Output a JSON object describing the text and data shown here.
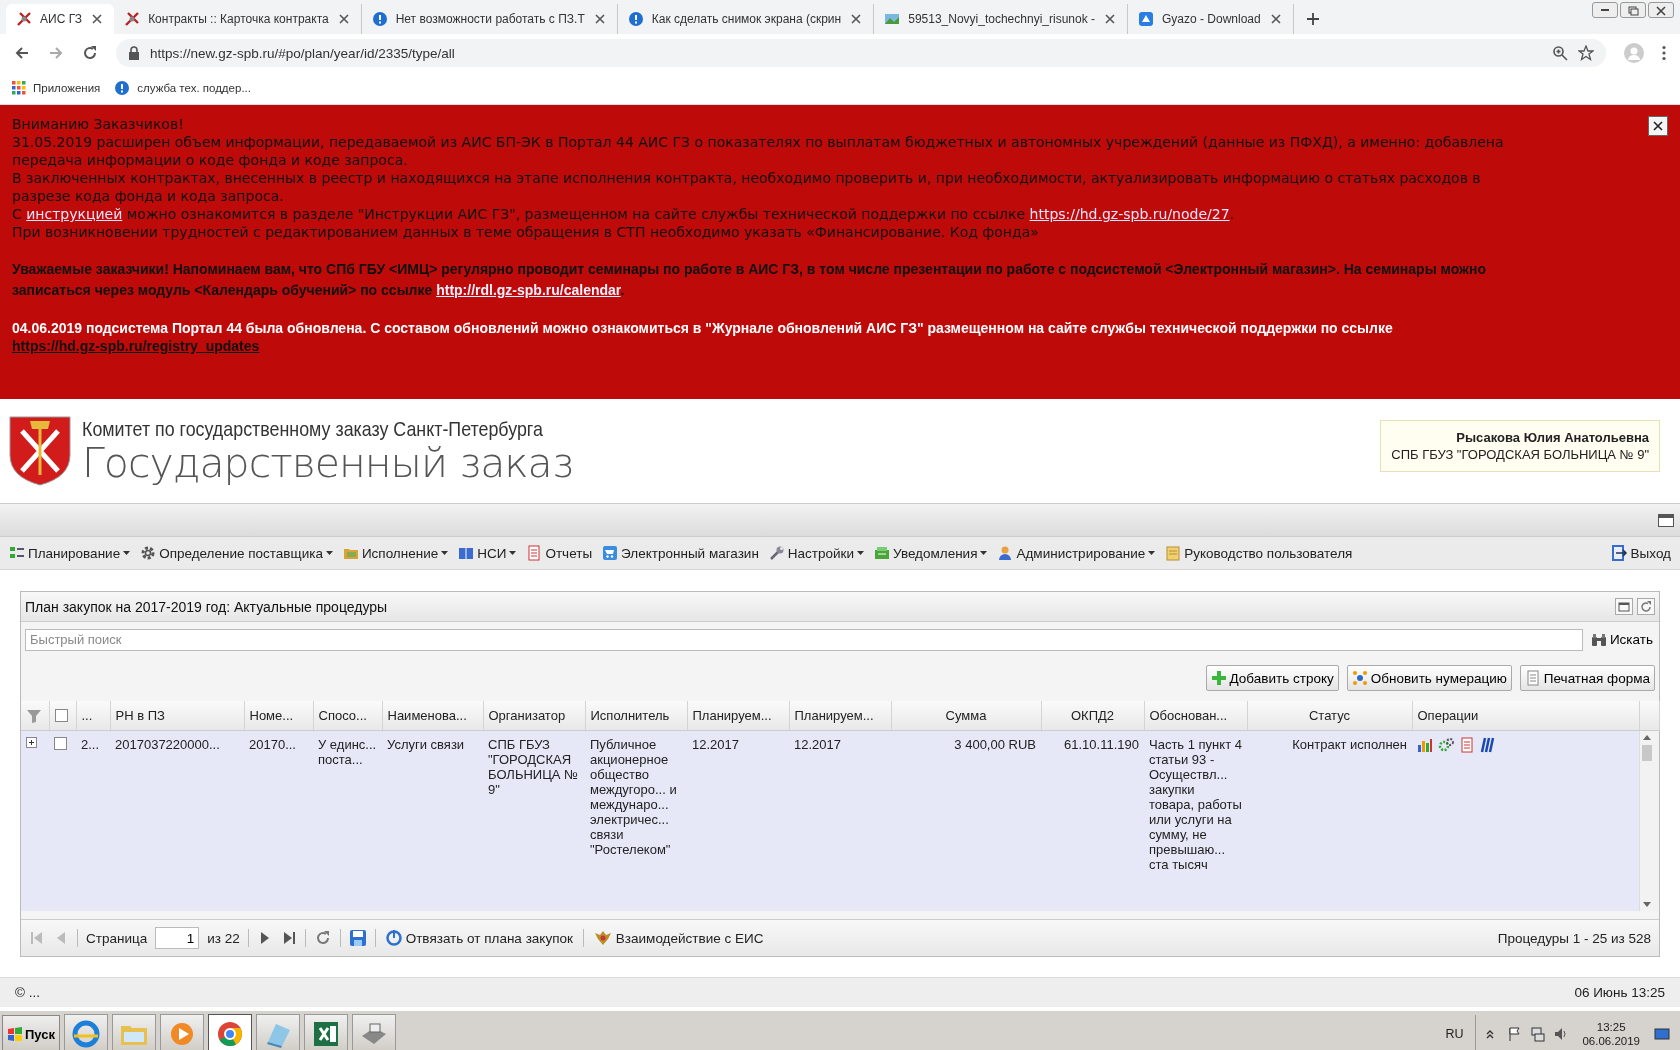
{
  "browser": {
    "tabs": [
      {
        "title": "АИС ГЗ",
        "selected": true
      },
      {
        "title": "Контракты :: Карточка контракта",
        "selected": false
      },
      {
        "title": "Нет возможности работать с ПЗ.Т",
        "selected": false
      },
      {
        "title": "Как сделать снимок экрана (скрин",
        "selected": false
      },
      {
        "title": "59513_Novyi_tochechnyi_risunok -",
        "selected": false
      },
      {
        "title": "Gyazo - Download",
        "selected": false
      }
    ],
    "address": "https://new.gz-spb.ru/#po/plan/year/id/2335/type/all",
    "bookmarks": [
      "Приложения",
      "служба тех. поддер..."
    ]
  },
  "banner": {
    "paragraphs": [
      {
        "kind": "notice",
        "lines": [
          [
            {
              "text": "Вниманию Заказчиков!"
            }
          ],
          [
            {
              "text": "31.05.2019 расширен объем информации, передаваемой из АИС БП-ЭК в Портал 44 АИС ГЗ о показателях по выплатам бюджетных и автономных учреждений (данные из ПФХД), а именно: добавлена передача информации о коде фонда и коде запроса."
            }
          ],
          [
            {
              "text": "В заключенных контрактах, внесенных в реестр и находящихся на этапе исполнения контракта, необходимо проверить и, при необходимости, актуализировать информацию о статьях расходов в разрезе кода фонда и кода запроса."
            }
          ],
          [
            {
              "text": "С "
            },
            {
              "link": "инструкцией"
            },
            {
              "text": " можно ознакомится в разделе \"Инструкции АИС ГЗ\", размещенном на сайте службы технической поддержки по ссылке "
            },
            {
              "link": "https://hd.gz-spb.ru/node/27"
            },
            {
              "text": "."
            }
          ],
          [
            {
              "text": "При возникновении трудностей с редактированием данных в теме обращения в СТП необходимо указать «Финансирование. Код фонда»"
            }
          ]
        ]
      },
      {
        "kind": "bold",
        "lines": [
          [
            {
              "text": "Уважаемые заказчики! Напоминаем вам, что СПб ГБУ <ИМЦ> регулярно проводит семинары по работе в АИС ГЗ, в том числе презентации по работе с подсистемой <Электронный магазин>. На семинары можно записаться через модуль <Календарь обучений> по ссылке "
            },
            {
              "link": "http://rdl.gz-spb.ru/calendar"
            },
            {
              "text": "."
            }
          ]
        ]
      },
      {
        "kind": "update",
        "lines": [
          [
            {
              "text": "04.06.2019 подсистема Портал 44 была обновлена. С составом обновлений можно ознакомиться в \"Журнале обновлений АИС ГЗ\" размещенном на сайте службы технической поддержки по ссылке "
            },
            {
              "link": "https://hd.gz-spb.ru/registry_updates"
            }
          ]
        ]
      }
    ]
  },
  "header": {
    "org": "Комитет по государственному заказу Санкт-Петербурга",
    "title": "Государственный заказ",
    "user": {
      "name": "Рысакова Юлия Анатольевна",
      "org": "СПБ ГБУЗ \"ГОРОДСКАЯ БОЛЬНИЦА № 9\""
    }
  },
  "menu": {
    "items": [
      {
        "label": "Планирование",
        "dropdown": true
      },
      {
        "label": "Определение поставщика",
        "dropdown": true
      },
      {
        "label": "Исполнение",
        "dropdown": true
      },
      {
        "label": "НСИ",
        "dropdown": true
      },
      {
        "label": "Отчеты",
        "dropdown": false
      },
      {
        "label": "Электронный магазин",
        "dropdown": false
      },
      {
        "label": "Настройки",
        "dropdown": true
      },
      {
        "label": "Уведомления",
        "dropdown": true
      },
      {
        "label": "Администрирование",
        "dropdown": true
      },
      {
        "label": "Руководство пользователя",
        "dropdown": false
      }
    ],
    "exit": "Выход"
  },
  "panel": {
    "title": "План закупок на 2017-2019 год: Актуальные процедуры",
    "search": {
      "placeholder": "Быстрый поиск",
      "button": "Искать"
    },
    "toolbar": [
      "Добавить строку",
      "Обновить нумерацию",
      "Печатная форма"
    ],
    "table": {
      "select_all": false,
      "columns": [
        "...",
        "РН в ПЗ",
        "Номе...",
        "Спосо...",
        "Наименова...",
        "Организатор",
        "Исполнитель",
        "Планируем...",
        "Планируем...",
        "Сумма",
        "ОКПД2",
        "Обоснован...",
        "Статус",
        "Операции"
      ],
      "rows": [
        {
          "expanded": false,
          "checked": false,
          "cells": [
            "2...",
            "2017037220000...",
            "20170...",
            "У единс... поста...",
            "Услуги связи",
            "СПБ ГБУЗ \"ГОРОДСКАЯ БОЛЬНИЦА № 9\"",
            "Публичное акционерное общество междугоро... и междунаро... электричес... связи \"Ростелеком\"",
            "12.2017",
            "12.2017",
            "3 400,00 RUB",
            "61.10.11.190",
            "Часть 1 пункт 4 статьи 93 - Осуществл... закупки товара, работы или услуги на сумму, не превышаю... ста тысяч",
            "Контракт исполнен"
          ]
        }
      ]
    },
    "pager": {
      "back": [
        {
          "kind": "first",
          "disabled": true
        },
        {
          "kind": "prev",
          "disabled": true
        }
      ],
      "page_label": "Страница",
      "page": "1",
      "of": "из 22",
      "forward": [
        {
          "kind": "next",
          "disabled": false
        },
        {
          "kind": "last",
          "disabled": false
        }
      ],
      "unlink": "Отвязать от плана закупок",
      "eis": "Взаимодействие с ЕИС",
      "summary": "Процедуры 1 - 25 из 528"
    }
  },
  "footer": {
    "copyright": "© ...",
    "datetime": "06 Июнь 13:25"
  },
  "taskbar": {
    "start": "Пуск",
    "apps": [
      {
        "selected": false
      },
      {
        "selected": false
      },
      {
        "selected": false
      },
      {
        "selected": true
      },
      {
        "selected": false
      },
      {
        "selected": false
      },
      {
        "selected": false
      }
    ],
    "language": "RU",
    "time": "13:25",
    "date": "06.06.2019"
  }
}
